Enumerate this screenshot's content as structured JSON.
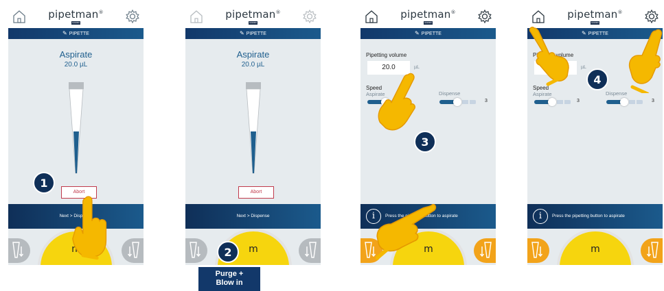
{
  "brand": {
    "name": "pipetman",
    "trademark": "®",
    "badge": "RAININ"
  },
  "mode_label": "PIPETTE",
  "screen1": {
    "action_title": "Aspirate",
    "action_volume": "20.0 µL",
    "abort_label": "Abort",
    "info_text": "Next > Dispense",
    "wheel_label": "m",
    "step": "1"
  },
  "screen2": {
    "action_title": "Aspirate",
    "action_volume": "20.0 µL",
    "abort_label": "Abort",
    "info_text": "Next > Dispense",
    "wheel_label": "m",
    "step": "2",
    "purge_line1": "Purge +",
    "purge_line2": "Blow in"
  },
  "screen3": {
    "volume_label": "Pipetting volume",
    "volume_value": "20.0",
    "volume_unit": "µL",
    "speed_label": "Speed",
    "aspirate_label": "Aspirate",
    "dispense_label": "Dispense",
    "aspirate_speed": "3",
    "dispense_speed": "3",
    "info_text": "Press the pipetting button to aspirate",
    "wheel_label": "m",
    "step": "3"
  },
  "screen4": {
    "volume_label": "Pipetting volume",
    "volume_unit": "µL",
    "speed_label": "Speed",
    "aspirate_label": "Aspirate",
    "dispense_label": "Dispense",
    "aspirate_speed": "3",
    "dispense_speed": "3",
    "info_text": "Press the pipetting button to aspirate",
    "wheel_label": "m",
    "step": "4"
  },
  "colors": {
    "accent": "#1f5f8e",
    "navy": "#0f2f58",
    "wheel": "#f6d50e",
    "hand": "#f5b800",
    "abort": "#c0394b",
    "orange": "#f2a31a"
  },
  "icons": [
    "home-icon",
    "gear-icon",
    "pencil-icon",
    "info-icon",
    "tip-down-icon",
    "pointing-hand-icon"
  ]
}
